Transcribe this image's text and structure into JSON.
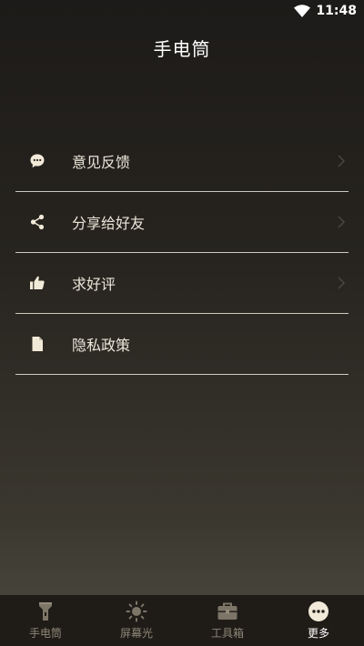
{
  "status_bar": {
    "time": "11:48",
    "icons": [
      "wifi-icon"
    ]
  },
  "header": {
    "title": "手电筒"
  },
  "menu": {
    "items": [
      {
        "label": "意见反馈",
        "icon": "feedback-chat-icon"
      },
      {
        "label": "分享给好友",
        "icon": "share-icon"
      },
      {
        "label": "求好评",
        "icon": "thumbs-up-icon"
      },
      {
        "label": "隐私政策",
        "icon": "document-icon"
      }
    ]
  },
  "tabs": {
    "items": [
      {
        "label": "手电筒",
        "icon": "flashlight-icon",
        "active": false
      },
      {
        "label": "屏幕光",
        "icon": "sun-icon",
        "active": false
      },
      {
        "label": "工具箱",
        "icon": "toolbox-icon",
        "active": false
      },
      {
        "label": "更多",
        "icon": "more-icon",
        "active": true
      }
    ]
  },
  "colors": {
    "text": "#ece6da",
    "divider": "#cfcac0",
    "tab_inactive": "#8e8677",
    "tab_active": "#ffffff",
    "icon_tint": "#f2ead8"
  }
}
